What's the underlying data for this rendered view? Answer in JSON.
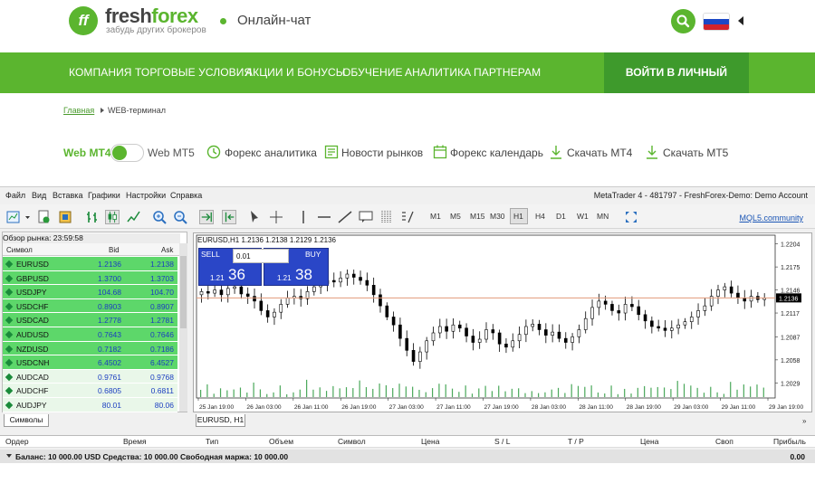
{
  "header": {
    "logo_mark": "ff",
    "logo_part1": "fresh",
    "logo_part2": "forex",
    "tagline": "забудь других брокеров",
    "chat_label": "Онлайн-чат",
    "icons": {
      "search": "search-icon",
      "language": "russian-flag-icon",
      "lang_menu": "caret-left-icon"
    }
  },
  "nav": {
    "items": [
      "КОМПАНИЯ",
      "ТОРГОВЫЕ УСЛОВИЯ",
      "АКЦИИ И БОНУСЫ",
      "ОБУЧЕНИЕ",
      "АНАЛИТИКА",
      "ПАРТНЕРАМ"
    ],
    "login_label": "ВОЙТИ В ЛИЧНЫЙ КАБИНЕТ"
  },
  "breadcrumb": {
    "home": "Главная",
    "current": "WEB-терминал"
  },
  "subbar": {
    "mt4_label": "Web MT4",
    "mt5_label": "Web MT5",
    "links": [
      {
        "label": "Форекс аналитика",
        "icon": "chart-clock-icon"
      },
      {
        "label": "Новости рынков",
        "icon": "newspaper-icon"
      },
      {
        "label": "Форекс календарь",
        "icon": "calendar-icon"
      },
      {
        "label": "Скачать МТ4",
        "icon": "download-icon"
      },
      {
        "label": "Скачать МТ5",
        "icon": "download-icon"
      }
    ]
  },
  "terminal": {
    "menu": [
      "Файл",
      "Вид",
      "Вставка",
      "Графики",
      "Настройки",
      "Справка"
    ],
    "account": "MetaTrader 4 - 481797 - FreshForex-Demo: Demo Account",
    "timeframes": [
      "M1",
      "M5",
      "M15",
      "M30",
      "H1",
      "H4",
      "D1",
      "W1",
      "MN"
    ],
    "active_timeframe": "H1",
    "mql_link": "MQL5.community",
    "market_watch": {
      "title": "Обзор рынка: 23:59:58",
      "col_symbol": "Символ",
      "col_bid": "Bid",
      "col_ask": "Ask",
      "tab": "Символы",
      "rows": [
        {
          "symbol": "EURUSD",
          "bid": "1.2136",
          "ask": "1.2138",
          "hl": true
        },
        {
          "symbol": "GBPUSD",
          "bid": "1.3700",
          "ask": "1.3703",
          "hl": true
        },
        {
          "symbol": "USDJPY",
          "bid": "104.68",
          "ask": "104.70",
          "hl": true
        },
        {
          "symbol": "USDCHF",
          "bid": "0.8903",
          "ask": "0.8907",
          "hl": true
        },
        {
          "symbol": "USDCAD",
          "bid": "1.2778",
          "ask": "1.2781",
          "hl": true
        },
        {
          "symbol": "AUDUSD",
          "bid": "0.7643",
          "ask": "0.7646",
          "hl": true
        },
        {
          "symbol": "NZDUSD",
          "bid": "0.7182",
          "ask": "0.7186",
          "hl": true
        },
        {
          "symbol": "USDCNH",
          "bid": "6.4502",
          "ask": "6.4527",
          "hl": true
        },
        {
          "symbol": "AUDCAD",
          "bid": "0.9761",
          "ask": "0.9768",
          "hl": false
        },
        {
          "symbol": "AUDCHF",
          "bid": "0.6805",
          "ask": "0.6811",
          "hl": false
        },
        {
          "symbol": "AUDJPY",
          "bid": "80.01",
          "ask": "80.06",
          "hl": false
        }
      ]
    },
    "chart": {
      "title": "EURUSD,H1  1.2136 1.2138 1.2129 1.2136",
      "sell_label": "SELL",
      "buy_label": "BUY",
      "lot": "0.01",
      "sell_price_small": "1.21",
      "sell_price_big": "36",
      "buy_price_small": "1.21",
      "buy_price_big": "38",
      "tab": "EURUSD, H1"
    },
    "trade_table": {
      "columns": [
        "Ордер",
        "Время",
        "Тип",
        "Объем",
        "Символ",
        "Цена",
        "S / L",
        "T / P",
        "Цена",
        "Своп",
        "Прибыль"
      ],
      "balance_line": "Баланс: 10 000.00 USD  Средства: 10 000.00  Свободная маржа: 10 000.00",
      "total": "0.00"
    }
  },
  "chart_data": {
    "type": "candlestick",
    "symbol": "EURUSD",
    "timeframe": "H1",
    "x": [
      "25 Jan 19:00",
      "26 Jan 03:00",
      "26 Jan 11:00",
      "26 Jan 19:00",
      "27 Jan 03:00",
      "27 Jan 11:00",
      "27 Jan 19:00",
      "28 Jan 03:00",
      "28 Jan 11:00",
      "28 Jan 19:00",
      "29 Jan 03:00",
      "29 Jan 11:00",
      "29 Jan 19:00"
    ],
    "ylim": [
      1.201,
      1.2215
    ],
    "y_ticks": [
      "1.2204",
      "1.2175",
      "1.2146",
      "1.2117",
      "1.2087",
      "1.2058",
      "1.2029"
    ],
    "current_price": "1.2136",
    "close": [
      1.2144,
      1.2142,
      1.2146,
      1.214,
      1.2148,
      1.215,
      1.2141,
      1.2138,
      1.2132,
      1.212,
      1.2112,
      1.2118,
      1.2128,
      1.2136,
      1.2138,
      1.2135,
      1.2144,
      1.215,
      1.2154,
      1.2158,
      1.2156,
      1.2161,
      1.2166,
      1.2162,
      1.2158,
      1.2152,
      1.214,
      1.2126,
      1.2112,
      1.2102,
      1.2085,
      1.207,
      1.2056,
      1.2068,
      1.2082,
      1.2092,
      1.21,
      1.2094,
      1.2102,
      1.2098,
      1.2088,
      1.208,
      1.2084,
      1.2096,
      1.2092,
      1.2078,
      1.2074,
      1.2082,
      1.209,
      1.21,
      1.2103,
      1.2096,
      1.2089,
      1.2093,
      1.2085,
      1.208,
      1.2087,
      1.2096,
      1.211,
      1.2124,
      1.2132,
      1.2128,
      1.212,
      1.2117,
      1.2128,
      1.2125,
      1.2115,
      1.2107,
      1.21,
      1.2098,
      1.2095,
      1.2098,
      1.2102,
      1.2106,
      1.2112,
      1.212,
      1.2126,
      1.2138,
      1.2146,
      1.215,
      1.2142,
      1.2136,
      1.2132,
      1.2138,
      1.2134,
      1.2136
    ],
    "volume_note": "volume bars shown at bottom"
  }
}
